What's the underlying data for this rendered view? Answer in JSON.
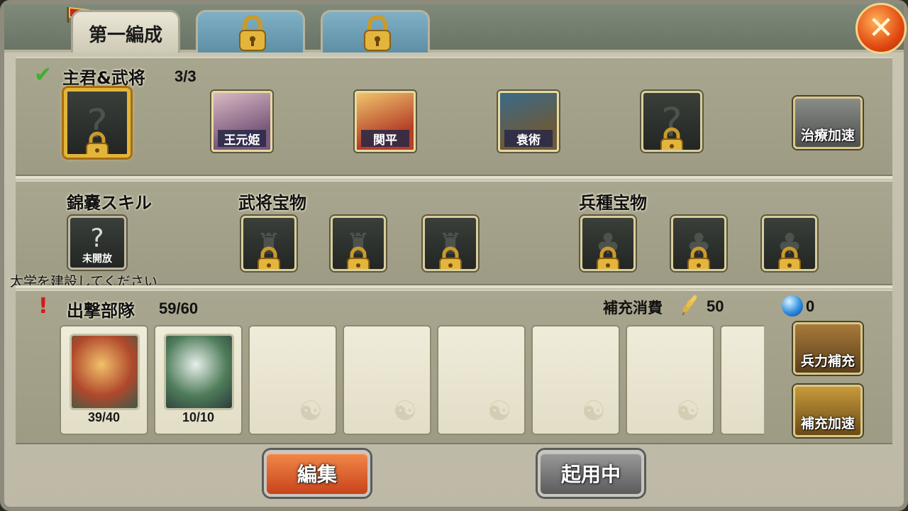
{
  "tabs": [
    {
      "label": "第一編成",
      "locked": false
    },
    {
      "label": "",
      "locked": true
    },
    {
      "label": "",
      "locked": true
    }
  ],
  "close_icon": "close-icon",
  "lord_section": {
    "title": "主君&武将",
    "count": "3/3",
    "generals": [
      {
        "name": "王元姫",
        "color": "#7a5a7c"
      },
      {
        "name": "関平",
        "color": "#b5402a"
      },
      {
        "name": "袁術",
        "color": "#6b5a3a"
      }
    ],
    "heal_button": "治療加速"
  },
  "skill_section": {
    "title": "錦嚢スキル",
    "slot_label": "未開放",
    "hint": "太学を建設してください"
  },
  "general_treasure": {
    "title": "武将宝物"
  },
  "unit_treasure": {
    "title": "兵種宝物"
  },
  "troops": {
    "title": "出撃部隊",
    "count": "59/60",
    "refill_cost_label": "補充消費",
    "refill_cost_value": "50",
    "gem_value": "0",
    "units": [
      {
        "qty": "39/40",
        "color": "#b0482c"
      },
      {
        "qty": "10/10",
        "color": "#4f7c5a"
      }
    ],
    "refill_button": "兵力補充",
    "refill_speed_button": "補充加速"
  },
  "footer": {
    "edit_button": "編集",
    "active_button": "起用中"
  }
}
